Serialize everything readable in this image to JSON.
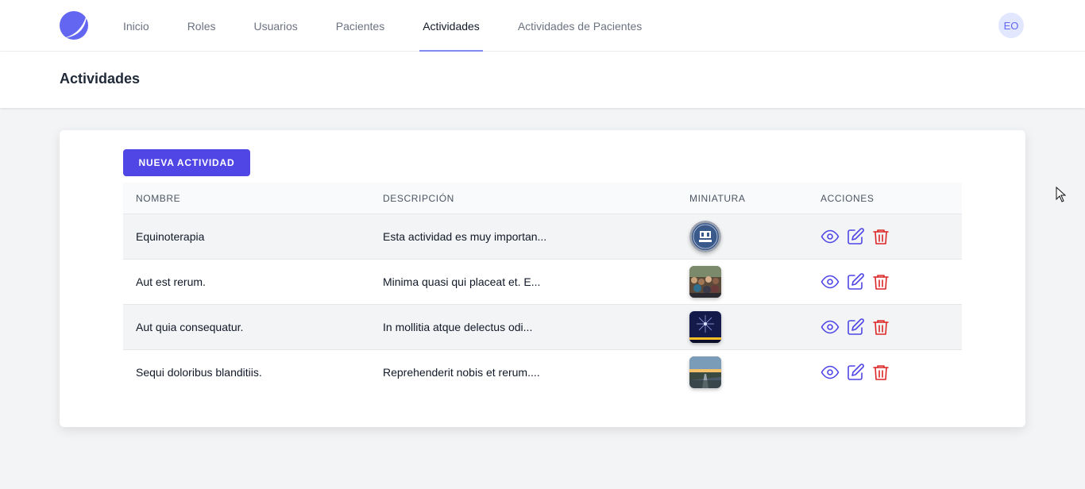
{
  "nav": {
    "links": [
      "Inicio",
      "Roles",
      "Usuarios",
      "Pacientes",
      "Actividades",
      "Actividades de Pacientes"
    ],
    "active": "Actividades",
    "avatar_initials": "EO"
  },
  "header": {
    "title": "Actividades"
  },
  "main": {
    "new_button_label": "NUEVA ACTIVIDAD",
    "table": {
      "headers": [
        "NOMBRE",
        "DESCRIPCIÓN",
        "MINIATURA",
        "ACCIONES"
      ],
      "rows": [
        {
          "nombre": "Equinoterapia",
          "descripcion": "Esta actividad es muy importan...",
          "miniatura": "ideal-logo-round"
        },
        {
          "nombre": "Aut est rerum.",
          "descripcion": "Minima quasi qui placeat et. E...",
          "miniatura": "crowd-photo"
        },
        {
          "nombre": "Aut quia consequatur.",
          "descripcion": "In mollitia atque delectus odi...",
          "miniatura": "fireworks-photo"
        },
        {
          "nombre": "Sequi doloribus blanditiis.",
          "descripcion": "Reprehenderit nobis et rerum....",
          "miniatura": "sunset-road-photo"
        }
      ],
      "action_icons": [
        "eye-icon",
        "pencil-square-icon",
        "trash-icon"
      ]
    }
  },
  "colors": {
    "primary": "#4f46e5",
    "nav_underline": "#818cf8",
    "view_edit_icon": "#4f46e5",
    "delete_icon": "#dc2626",
    "page_bg": "#f3f4f6"
  }
}
